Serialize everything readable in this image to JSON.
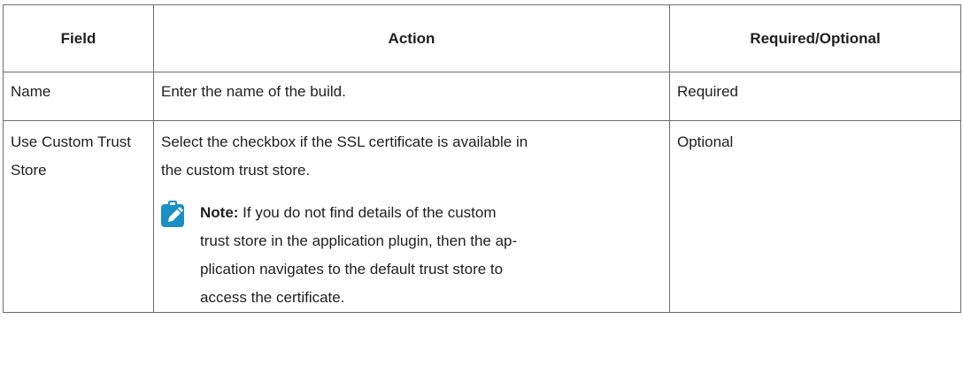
{
  "table": {
    "headers": {
      "field": "Field",
      "action": "Action",
      "required": "Required/Optional"
    },
    "rows": [
      {
        "field": "Name",
        "action": "Enter the name of the build.",
        "required": "Required"
      },
      {
        "field_line1": "Use Custom Trust",
        "field_line2": "Store",
        "action_line1": "Select the checkbox if the SSL certificate is available in",
        "action_line2": "the custom trust store.",
        "required": "Optional",
        "note": {
          "label": "Note:",
          "lines": [
            " If you do not find details of the custom",
            "trust store in the application plugin, then the ap-",
            "plication navigates to the default trust store to",
            "access the certificate."
          ]
        }
      }
    ]
  },
  "colors": {
    "note_icon": "#1a8fc4",
    "border": "#6e6e6e"
  },
  "icons": {
    "note": "pencil-note-icon"
  }
}
